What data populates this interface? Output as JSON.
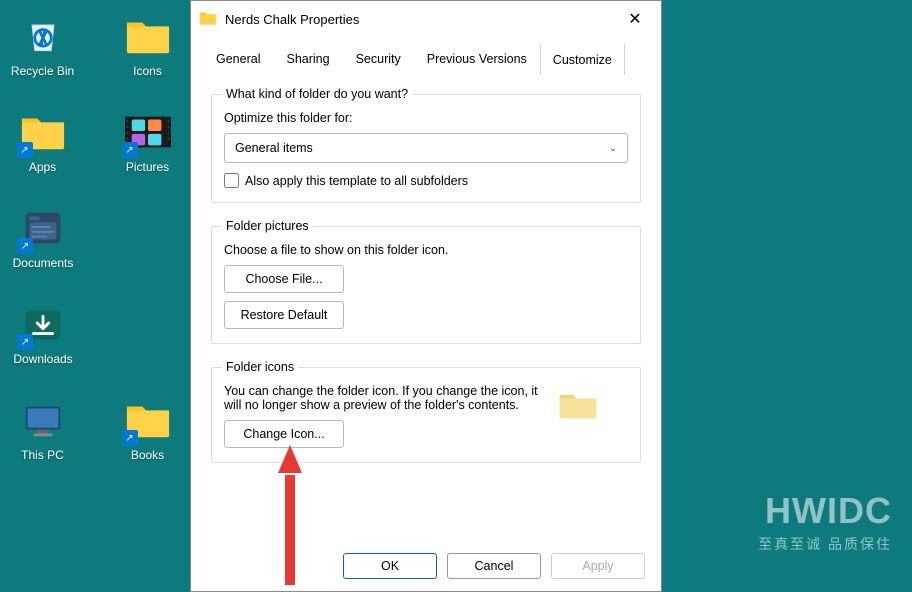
{
  "desktop": {
    "icons": [
      {
        "label": "Recycle Bin"
      },
      {
        "label": "Icons"
      },
      {
        "label": "Apps"
      },
      {
        "label": "Pictures"
      },
      {
        "label": "Documents"
      },
      {
        "label": "Downloads"
      },
      {
        "label": "This PC"
      },
      {
        "label": "Books"
      }
    ]
  },
  "dialog": {
    "title": "Nerds Chalk Properties",
    "tabs": [
      "General",
      "Sharing",
      "Security",
      "Previous Versions",
      "Customize"
    ],
    "active_tab": "Customize",
    "group1": {
      "legend": "What kind of folder do you want?",
      "optimize_label": "Optimize this folder for:",
      "dropdown_value": "General items",
      "checkbox_label": "Also apply this template to all subfolders"
    },
    "group2": {
      "legend": "Folder pictures",
      "text": "Choose a file to show on this folder icon.",
      "choose_file": "Choose File...",
      "restore_default": "Restore Default"
    },
    "group3": {
      "legend": "Folder icons",
      "text": "You can change the folder icon. If you change the icon, it will no longer show a preview of the folder's contents.",
      "change_icon": "Change Icon..."
    },
    "buttons": {
      "ok": "OK",
      "cancel": "Cancel",
      "apply": "Apply"
    }
  },
  "watermark": {
    "big": "HWIDC",
    "small": "至真至诚  品质保住"
  }
}
